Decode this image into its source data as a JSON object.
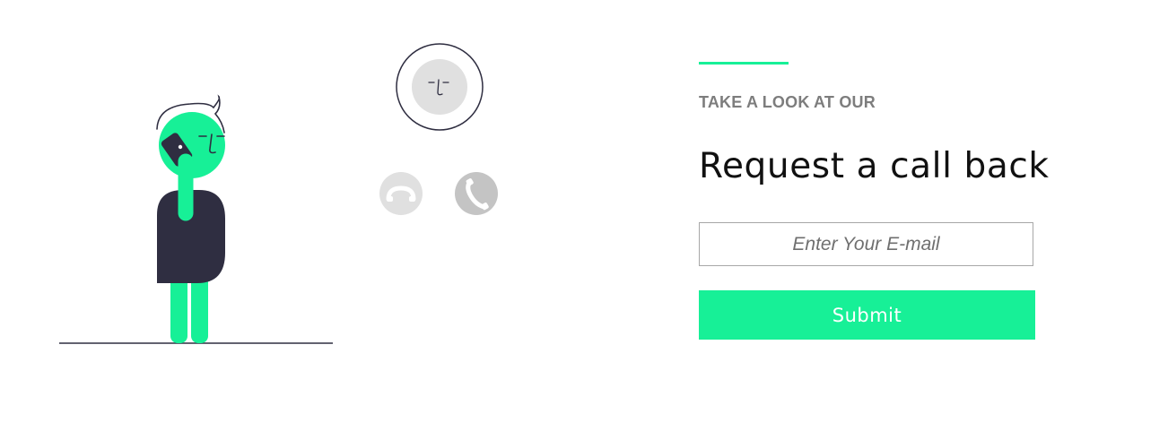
{
  "colors": {
    "accent": "#17f097",
    "dark": "#2f2e41",
    "muted_text": "#7d7d7d",
    "heading_text": "#111111",
    "icon_gray": "#e0e0e0",
    "icon_gray_dark": "#c4c4c4"
  },
  "illustration": {
    "icons": [
      "person-on-phone-illustration",
      "caller-avatar-icon",
      "hang-up-phone-icon",
      "answer-phone-icon"
    ]
  },
  "form": {
    "eyebrow": "TAKE A LOOK AT OUR",
    "title": "Request a call back",
    "email_placeholder": "Enter Your E-mail",
    "email_value": "",
    "submit_label": "Submit"
  }
}
